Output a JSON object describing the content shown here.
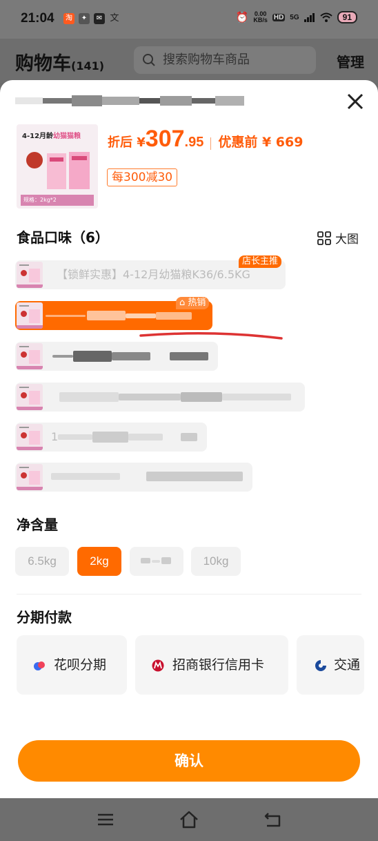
{
  "status": {
    "time": "21:04",
    "net_speed_value": "0.00",
    "net_speed_unit": "KB/s",
    "hd": "HD",
    "network": "5G",
    "battery": "91"
  },
  "cart": {
    "title": "购物车",
    "count": "(141)",
    "search_placeholder": "搜索购物车商品",
    "manage_label": "管理"
  },
  "product": {
    "thumb_prefix": "4-12月龄",
    "thumb_highlight": "幼猫猫粮",
    "thumb_spec": "规格：2kg*2",
    "price_label": "折后 ¥",
    "price_main": "307",
    "price_decimal": ".95",
    "original_price": "优惠前 ¥ 669",
    "promo": "每300减30"
  },
  "flavor": {
    "title": "食品口味（6）",
    "big_view_label": "大图",
    "options": [
      {
        "label": "【锁鲜实惠】4-12月幼猫粮K36/6.5KG",
        "badge": "店长主推"
      },
      {
        "label": "",
        "badge": "热销"
      },
      {
        "label": ""
      },
      {
        "label": ""
      },
      {
        "label": "1"
      },
      {
        "label": ""
      }
    ]
  },
  "net_weight": {
    "title": "净含量",
    "options": [
      "6.5kg",
      "2kg",
      "",
      "10kg"
    ],
    "selected": "2kg"
  },
  "installment": {
    "title": "分期付款",
    "options": [
      "花呗分期",
      "招商银行信用卡",
      "交通"
    ]
  },
  "confirm_label": "确认",
  "colors": {
    "accent": "#ff6a00",
    "button": "#ff8a00",
    "price": "#ff5c0a"
  }
}
